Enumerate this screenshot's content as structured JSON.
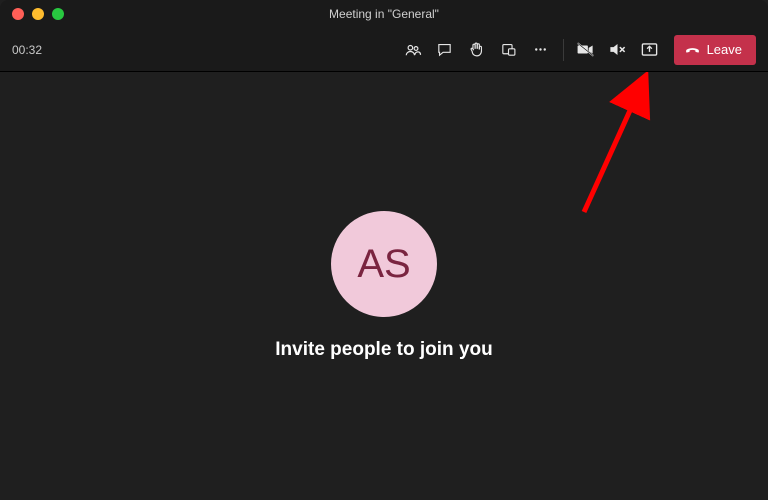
{
  "window": {
    "title": "Meeting in \"General\""
  },
  "toolbar": {
    "timer": "00:32",
    "leave_label": "Leave"
  },
  "participant": {
    "initials": "AS"
  },
  "invite_message": "Invite people to join you",
  "colors": {
    "leave": "#c4314b",
    "avatar_bg": "#f1c9da",
    "avatar_fg": "#7a2440",
    "arrow": "#ff0000"
  }
}
